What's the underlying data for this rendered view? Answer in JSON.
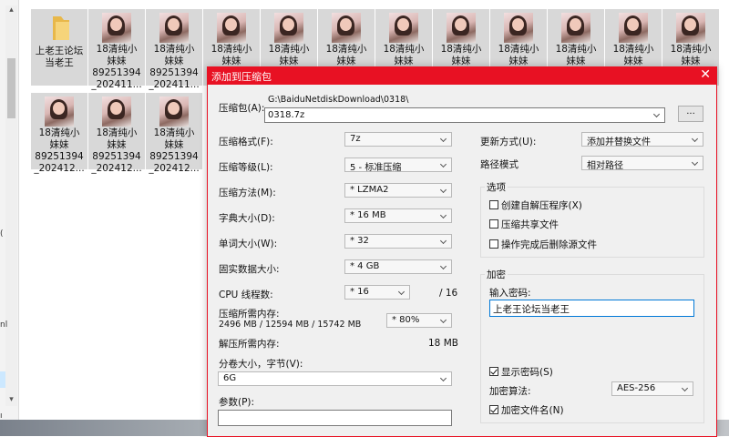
{
  "explorer": {
    "files": [
      {
        "line1": "上老王论坛",
        "line2": "当老王",
        "type": "folder"
      },
      {
        "line1": "18清纯小",
        "line2": "妹妹",
        "line3": "89251394",
        "line4": "_202411...",
        "type": "photo"
      },
      {
        "line1": "18清纯小",
        "line2": "妹妹",
        "line3": "89251394",
        "line4": "_202411...",
        "type": "photo"
      },
      {
        "line1": "18清纯小",
        "line2": "妹妹",
        "type": "photo"
      },
      {
        "line1": "18清纯小",
        "line2": "妹妹",
        "type": "photo"
      },
      {
        "line1": "18清纯小",
        "line2": "妹妹",
        "type": "photo"
      },
      {
        "line1": "18清纯小",
        "line2": "妹妹",
        "type": "photo"
      },
      {
        "line1": "18清纯小",
        "line2": "妹妹",
        "type": "photo"
      },
      {
        "line1": "18清纯小",
        "line2": "妹妹",
        "type": "photo"
      },
      {
        "line1": "18清纯小",
        "line2": "妹妹",
        "type": "photo"
      },
      {
        "line1": "18清纯小",
        "line2": "妹妹",
        "type": "photo"
      },
      {
        "line1": "18清纯小",
        "line2": "妹妹",
        "type": "photo"
      },
      {
        "line1": "18清纯小",
        "line2": "妹妹",
        "line3": "89251394",
        "line4": "_202412...",
        "type": "photo"
      },
      {
        "line1": "18清纯小",
        "line2": "妹妹",
        "line3": "89251394",
        "line4": "_202412...",
        "type": "photo"
      },
      {
        "line1": "18清纯小",
        "line2": "妹妹",
        "line3": "89251394",
        "line4": "_202412...",
        "type": "photo"
      }
    ],
    "left_fragments": [
      "(",
      "nl",
      "ı"
    ]
  },
  "dialog": {
    "title": "添加到压缩包",
    "close_glyph": "✕",
    "archive_label": "压缩包(A):",
    "archive_dir": "G:\\BaiduNetdiskDownload\\0318\\",
    "archive_name": "0318.7z",
    "browse_label": "...",
    "format_label": "压缩格式(F):",
    "format_value": "7z",
    "level_label": "压缩等级(L):",
    "level_value": "5 - 标准压缩",
    "method_label": "压缩方法(M):",
    "method_value": "* LZMA2",
    "dict_label": "字典大小(D):",
    "dict_value": "* 16 MB",
    "word_label": "单词大小(W):",
    "word_value": "* 32",
    "solid_label": "固实数据大小:",
    "solid_value": "* 4 GB",
    "threads_label": "CPU 线程数:",
    "threads_value": "* 16",
    "threads_total": "/ 16",
    "mem_comp_label": "压缩所需内存:",
    "mem_comp_detail": "2496 MB / 12594 MB / 15742 MB",
    "mem_percent_value": "* 80%",
    "mem_decomp_label": "解压所需内存:",
    "mem_decomp_value": "18 MB",
    "split_label": "分卷大小，字节(V):",
    "split_value": "6G",
    "params_label": "参数(P):",
    "params_value": "",
    "update_label": "更新方式(U):",
    "update_value": "添加并替换文件",
    "path_label": "路径模式",
    "path_value": "相对路径",
    "options_title": "选项",
    "opt_sfx": "创建自解压程序(X)",
    "opt_shared": "压缩共享文件",
    "opt_delete": "操作完成后删除源文件",
    "encrypt_title": "加密",
    "password_label": "输入密码:",
    "password_value": "上老王论坛当老王",
    "show_password": "显示密码(S)",
    "enc_method_label": "加密算法:",
    "enc_method_value": "AES-256",
    "encrypt_names": "加密文件名(N)"
  }
}
